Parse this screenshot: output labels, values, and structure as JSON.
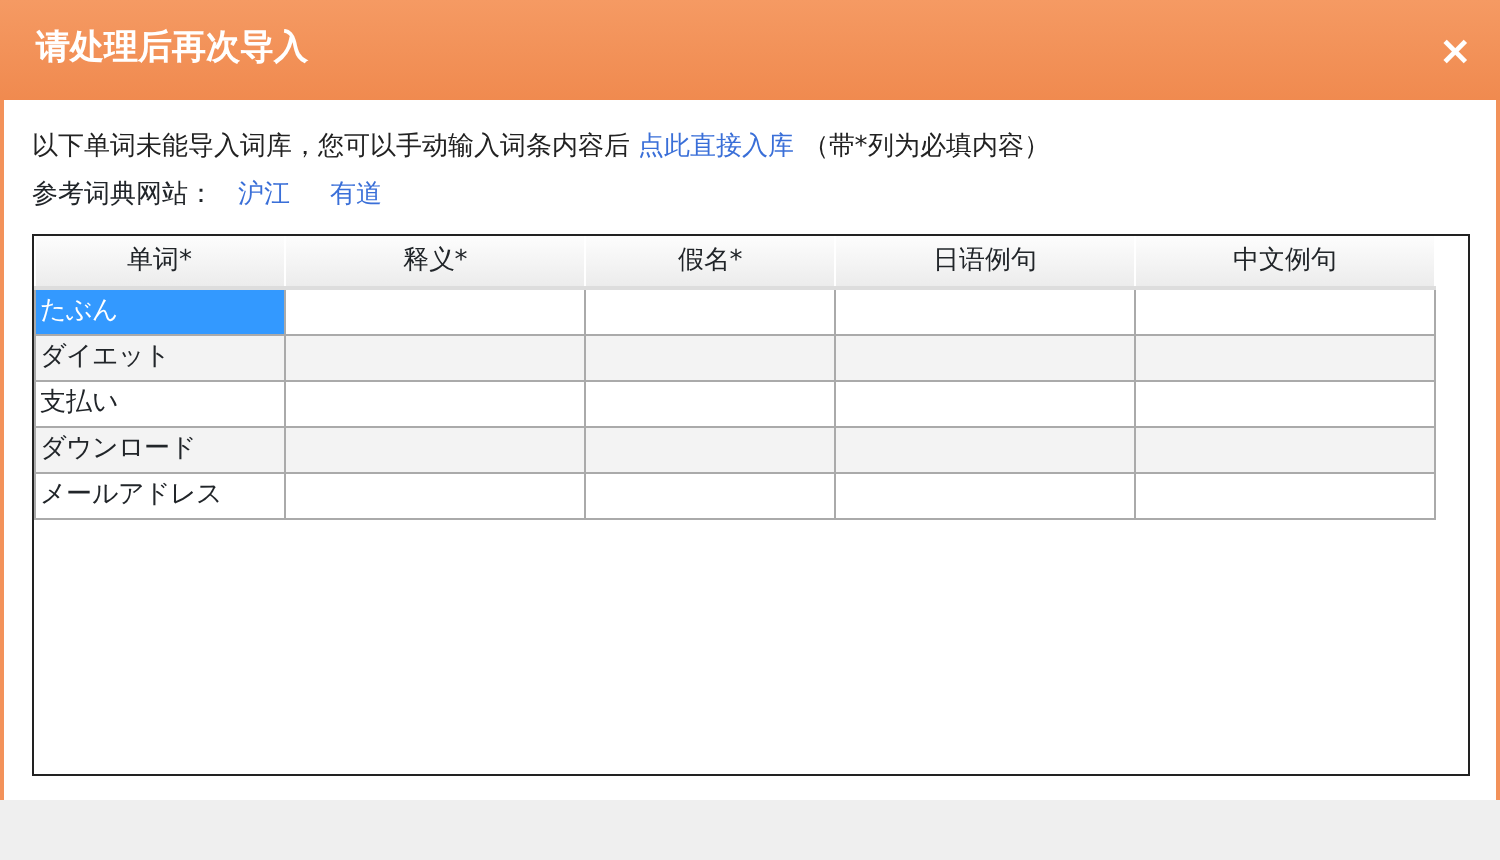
{
  "window": {
    "title": "请处理后再次导入",
    "close": "×"
  },
  "intro": {
    "before": "以下单词未能导入词库，您可以手动输入词条内容后 ",
    "link": "点此直接入库",
    "after": " （带*列为必填内容）"
  },
  "references": {
    "label": "参考词典网站：",
    "links": [
      "沪江",
      "有道"
    ]
  },
  "table": {
    "columns": [
      "单词*",
      "释义*",
      "假名*",
      "日语例句",
      "中文例句"
    ],
    "rows": [
      {
        "word": "たぶん",
        "selected": true
      },
      {
        "word": "ダイエット",
        "selected": false
      },
      {
        "word": "支払い",
        "selected": false
      },
      {
        "word": "ダウンロード",
        "selected": false
      },
      {
        "word": "メールアドレス",
        "selected": false
      }
    ]
  }
}
